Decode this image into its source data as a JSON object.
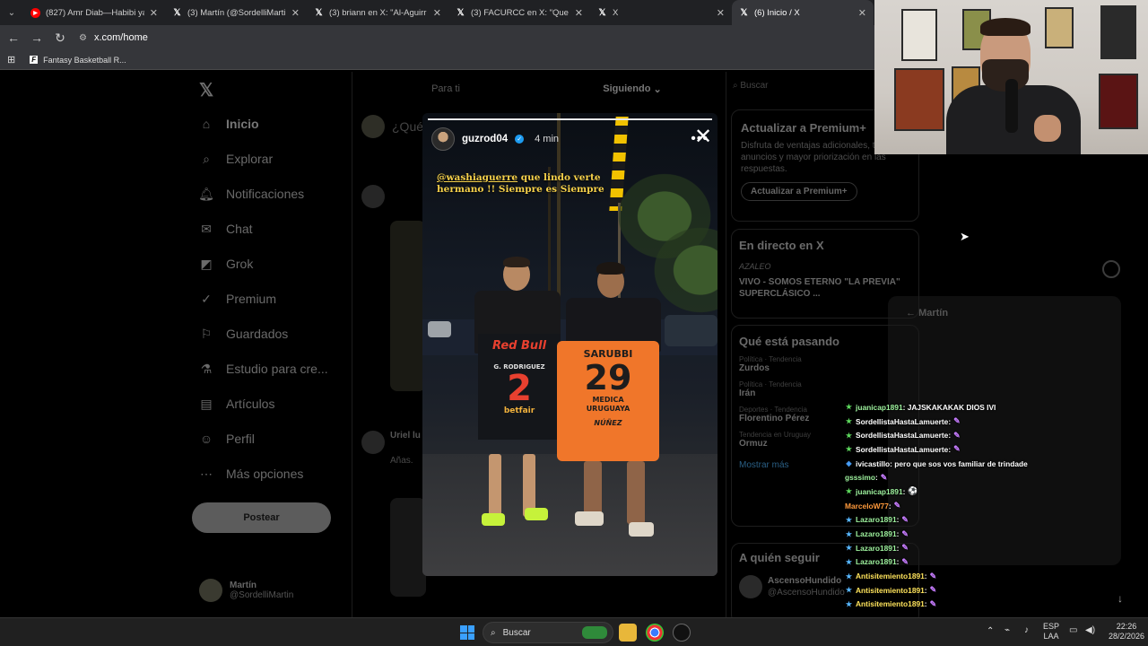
{
  "browser": {
    "tabs": [
      {
        "icon": "youtube-icon",
        "title": "(827) Amr Diab—Habibi ya Nour..."
      },
      {
        "icon": "x-icon",
        "title": "(3) Martín (@SordelliMartin) / X"
      },
      {
        "icon": "x-icon",
        "title": "(3) briann en X: \"Al-Aguirr DICT..."
      },
      {
        "icon": "x-icon",
        "title": "(3) FACURCC en X: \"Que buen o..."
      },
      {
        "icon": "x-icon",
        "title": "X"
      },
      {
        "icon": "x-icon",
        "title": "(6) Inicio / X"
      }
    ],
    "url": "x.com/home",
    "bookmark": "Fantasy Basketball R..."
  },
  "sidebar": {
    "items": [
      {
        "icon": "home-icon",
        "label": "Inicio"
      },
      {
        "icon": "search-icon",
        "label": "Explorar"
      },
      {
        "icon": "bell-icon",
        "label": "Notificaciones"
      },
      {
        "icon": "mail-icon",
        "label": "Chat"
      },
      {
        "icon": "grok-icon",
        "label": "Grok"
      },
      {
        "icon": "premium-icon",
        "label": "Premium"
      },
      {
        "icon": "bookmark-icon",
        "label": "Guardados"
      },
      {
        "icon": "flask-icon",
        "label": "Estudio para cre..."
      },
      {
        "icon": "article-icon",
        "label": "Artículos"
      },
      {
        "icon": "person-icon",
        "label": "Perfil"
      },
      {
        "icon": "more-icon",
        "label": "Más opciones"
      }
    ],
    "post_button": "Postear",
    "account_name": "Martín",
    "account_handle": "@SordelliMartin"
  },
  "timeline": {
    "tab_for_you": "Para ti",
    "tab_following": "Siguiendo",
    "compose_placeholder": "¿Qué",
    "post_author": "Uriel lu",
    "post_text": "Añas."
  },
  "right": {
    "search_placeholder": "Buscar",
    "premium_title": "Actualizar a Premium+",
    "premium_text": "Disfruta de ventajas adicionales, total de anuncios y mayor priorización en las respuestas.",
    "premium_button": "Actualizar a Premium+",
    "live_title": "En directo en X",
    "live_host": "AZALEO",
    "live_text": "VIVO - SOMOS ETERNO \"LA PREVIA\" SUPERCLÁSICO ...",
    "trends_title": "Qué está pasando",
    "trends": [
      {
        "sub": "Política · Tendencia",
        "name": "Zurdos"
      },
      {
        "sub": "Política · Tendencia",
        "name": "Irán"
      },
      {
        "sub": "Deportes · Tendencia",
        "name": "Florentino Pérez"
      },
      {
        "sub": "Tendencia en Uruguay",
        "name": "Ormuz"
      }
    ],
    "show_more": "Mostrar más",
    "follow_title": "A quién seguir",
    "follow_name": "AscensoHundido",
    "follow_handle": "@AscensoHundido"
  },
  "story": {
    "username": "guzrod04",
    "time": "4 min",
    "caption_tag": "@washiaguerre",
    "caption_rest": " que lindo verte hermano !! Siempre es Siempre",
    "jersey1_sponsor": "Red Bull",
    "jersey1_name": "G. RODRIGUEZ",
    "jersey1_number": "2",
    "jersey1_bottom": "betfair",
    "jersey2_name": "SARUBBI",
    "jersey2_number": "29",
    "jersey2_sponsor": "MEDICA URUGUAYA",
    "jersey2_bottom": "NÚÑEZ"
  },
  "dm_panel": {
    "name": "Martín"
  },
  "chat": [
    {
      "badge": "star-badge",
      "badge_color": "#5cd65c",
      "user": "juanicap1891",
      "user_color": "#9ef29e",
      "text": " : JAJSKAKAKAK DIOS IVI",
      "emote": ""
    },
    {
      "badge": "star-badge",
      "badge_color": "#5cd65c",
      "user": "SordellistaHastaLamuerte",
      "user_color": "#ffffff",
      "text": " :",
      "emote": "feather"
    },
    {
      "badge": "star-badge",
      "badge_color": "#5cd65c",
      "user": "SordellistaHastaLamuerte",
      "user_color": "#ffffff",
      "text": " :",
      "emote": "feather"
    },
    {
      "badge": "star-badge",
      "badge_color": "#5cd65c",
      "user": "SordellistaHastaLamuerte",
      "user_color": "#ffffff",
      "text": " :",
      "emote": "feather"
    },
    {
      "badge": "prime-badge",
      "badge_color": "#4aa3ff",
      "user": "ivicastillo",
      "user_color": "#ffffff",
      "text": " : pero que sos vos familiar de trindade",
      "emote": ""
    },
    {
      "badge": "",
      "badge_color": "",
      "user": "gsssimo",
      "user_color": "#9ef29e",
      "text": " :",
      "emote": "feather"
    },
    {
      "badge": "star-badge",
      "badge_color": "#5cd65c",
      "user": "juanicap1891",
      "user_color": "#9ef29e",
      "text": " :",
      "emote": "ball"
    },
    {
      "badge": "",
      "badge_color": "",
      "user": "MarceloW77",
      "user_color": "#ff9a3c",
      "text": " :",
      "emote": "feather"
    },
    {
      "badge": "star-badge",
      "badge_color": "#57b6ff",
      "user": "Lazaro1891",
      "user_color": "#9ef29e",
      "text": " :",
      "emote": "feather"
    },
    {
      "badge": "star-badge",
      "badge_color": "#57b6ff",
      "user": "Lazaro1891",
      "user_color": "#9ef29e",
      "text": " :",
      "emote": "feather"
    },
    {
      "badge": "star-badge",
      "badge_color": "#57b6ff",
      "user": "Lazaro1891",
      "user_color": "#9ef29e",
      "text": " :",
      "emote": "feather"
    },
    {
      "badge": "star-badge",
      "badge_color": "#57b6ff",
      "user": "Lazaro1891",
      "user_color": "#9ef29e",
      "text": " :",
      "emote": "feather"
    },
    {
      "badge": "star-badge",
      "badge_color": "#57b6ff",
      "user": "Antisitemiento1891",
      "user_color": "#ffe45c",
      "text": " :",
      "emote": "feather"
    },
    {
      "badge": "star-badge",
      "badge_color": "#57b6ff",
      "user": "Antisitemiento1891",
      "user_color": "#ffe45c",
      "text": " :",
      "emote": "feather"
    },
    {
      "badge": "star-badge",
      "badge_color": "#57b6ff",
      "user": "Antisitemiento1891",
      "user_color": "#ffe45c",
      "text": " :",
      "emote": "feather"
    }
  ],
  "taskbar": {
    "search": "Buscar",
    "lang_top": "ESP",
    "lang_bottom": "LAA",
    "time": "22:26",
    "date": "28/2/2026"
  }
}
